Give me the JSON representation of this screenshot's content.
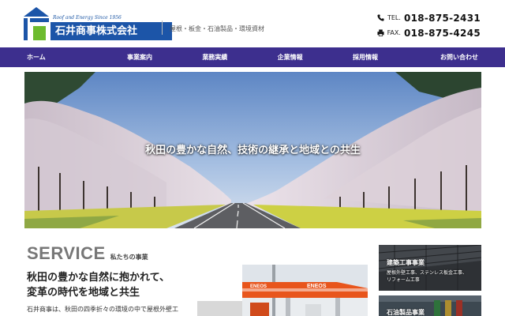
{
  "header": {
    "logo_tagline": "Roof and Energy Since 1956",
    "company_name": "石井商事株式会社",
    "business_lines": "屋根・板金・石油製品・環境資材",
    "phone_prefix": "TEL.",
    "phone": "018-875-2431",
    "fax_prefix": "FAX.",
    "fax": "018-875-4245",
    "icons": {
      "phone": "phone-icon",
      "fax": "fax-icon",
      "logo": "house-logo-icon"
    }
  },
  "nav": {
    "items": [
      {
        "label": "ホーム"
      },
      {
        "label": "事業案内"
      },
      {
        "label": "業務実績"
      },
      {
        "label": "企業情報"
      },
      {
        "label": "採用情報"
      },
      {
        "label": "お問い合わせ"
      }
    ]
  },
  "hero": {
    "caption": "秋田の豊かな自然、技術の継承と地域との共生"
  },
  "service": {
    "title": "SERVICE",
    "subtitle": "私たちの事業",
    "lead_line1": "秋田の豊かな自然に抱かれて、",
    "lead_line2": "変革の時代を地域と共生",
    "body": "石井商事は、秋田の四季折々の環境の中で屋根外壁工"
  },
  "station_sign": "ENEOS",
  "cards": [
    {
      "title": "建築工事事業",
      "desc_line1": "屋根外壁工事、ステンレス板金工事、",
      "desc_line2": "リフォーム工事"
    },
    {
      "title": "石油製品事業"
    }
  ],
  "colors": {
    "nav": "#3d2f8e",
    "brand_blue": "#1c55a8",
    "brand_green": "#6dbb2f",
    "heading_gray": "#777777"
  }
}
